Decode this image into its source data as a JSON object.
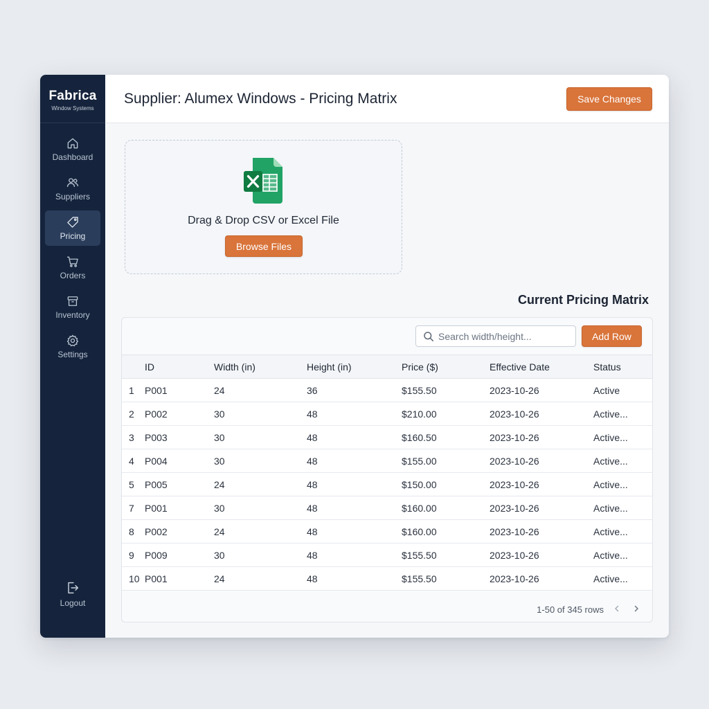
{
  "brand": {
    "name": "Fabrica",
    "subtitle": "Window Systems"
  },
  "nav": [
    {
      "label": "Dashboard",
      "icon": "home-icon"
    },
    {
      "label": "Suppliers",
      "icon": "users-icon"
    },
    {
      "label": "Pricing",
      "icon": "tag-icon",
      "active": true
    },
    {
      "label": "Orders",
      "icon": "cart-icon"
    },
    {
      "label": "Inventory",
      "icon": "box-icon"
    },
    {
      "label": "Settings",
      "icon": "gear-icon"
    }
  ],
  "logout_label": "Logout",
  "header": {
    "title": "Supplier: Alumex Windows - Pricing Matrix",
    "save_label": "Save Changes"
  },
  "upload": {
    "text": "Drag & Drop CSV or Excel File",
    "browse_label": "Browse Files",
    "icon": "excel-file-icon"
  },
  "section_title": "Current Pricing Matrix",
  "search": {
    "placeholder": "Search width/height..."
  },
  "add_row_label": "Add Row",
  "table": {
    "columns": [
      "",
      "ID",
      "Width (in)",
      "Height (in)",
      "Price ($)",
      "Effective Date",
      "Status"
    ],
    "rows": [
      [
        "1",
        "P001",
        "24",
        "36",
        "$155.50",
        "2023-10-26",
        "Active"
      ],
      [
        "2",
        "P002",
        "30",
        "48",
        "$210.00",
        "2023-10-26",
        "Active..."
      ],
      [
        "3",
        "P003",
        "30",
        "48",
        "$160.50",
        "2023-10-26",
        "Active..."
      ],
      [
        "4",
        "P004",
        "30",
        "48",
        "$155.00",
        "2023-10-26",
        "Active..."
      ],
      [
        "5",
        "P005",
        "24",
        "48",
        "$150.00",
        "2023-10-26",
        "Active..."
      ],
      [
        "7",
        "P001",
        "30",
        "48",
        "$160.00",
        "2023-10-26",
        "Active..."
      ],
      [
        "8",
        "P002",
        "24",
        "48",
        "$160.00",
        "2023-10-26",
        "Active..."
      ],
      [
        "9",
        "P009",
        "30",
        "48",
        "$155.50",
        "2023-10-26",
        "Active..."
      ],
      [
        "10",
        "P001",
        "24",
        "48",
        "$155.50",
        "2023-10-26",
        "Active..."
      ]
    ]
  },
  "pagination": {
    "text": "1-50 of 345 rows"
  },
  "colors": {
    "sidebar": "#15243c",
    "accent": "#d9743a",
    "excel_green": "#1f8a4c"
  }
}
